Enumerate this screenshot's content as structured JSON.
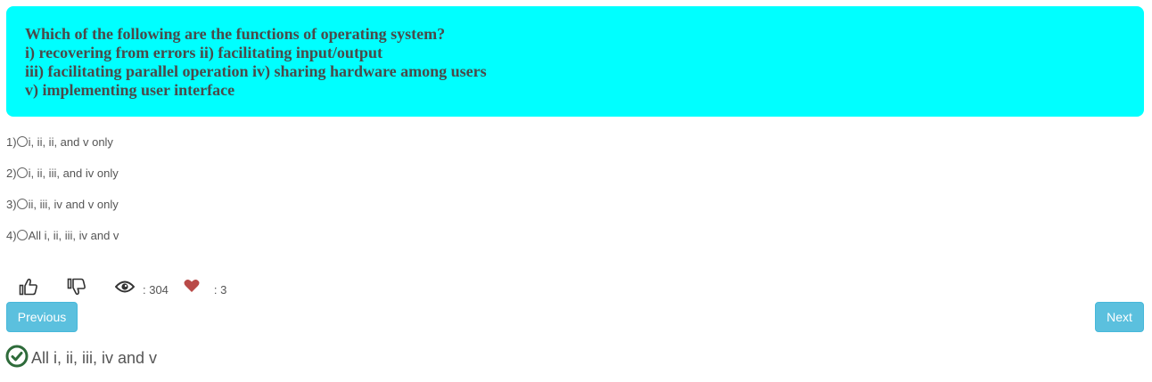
{
  "question": {
    "lines": [
      "Which of the following are the functions of operating system?",
      "i) recovering from errors ii) facilitating input/output",
      "iii) facilitating parallel operation iv) sharing hardware among users",
      "v) implementing user interface"
    ],
    "background_color": "#00ffff"
  },
  "options": [
    {
      "number": "1)",
      "text": "i, ii, ii, and v only"
    },
    {
      "number": "2)",
      "text": "i, ii, iii, and iv only"
    },
    {
      "number": "3)",
      "text": "ii, iii, iv and v only"
    },
    {
      "number": "4)",
      "text": "All i, ii, iii, iv and v"
    }
  ],
  "stats": {
    "views": ": 304",
    "likes": ": 3",
    "icons": [
      "thumbs-up-icon",
      "thumbs-down-icon",
      "eye-icon",
      "heart-icon"
    ],
    "heart_color": "#b94a48"
  },
  "navigation": {
    "previous_label": "Previous",
    "next_label": "Next",
    "button_color": "#5bc0de"
  },
  "answer": {
    "text": "All i, ii, iii, iv and v",
    "icon": "check-circle-icon",
    "icon_color": "#2e6b3a"
  }
}
